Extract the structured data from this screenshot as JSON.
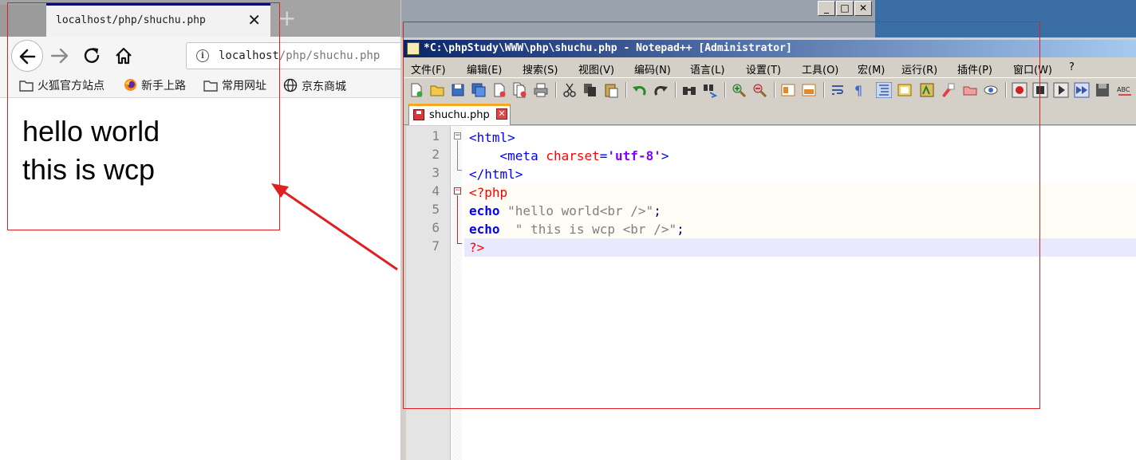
{
  "browser": {
    "tab_title": "localhost/php/shuchu.php",
    "tab_close": "✕",
    "new_tab": "+",
    "url_host": "localhost",
    "url_path": "/php/shuchu.php",
    "bookmarks": [
      {
        "label": "火狐官方站点",
        "icon": "folder-icon"
      },
      {
        "label": "新手上路",
        "icon": "firefox-icon"
      },
      {
        "label": "常用网址",
        "icon": "folder-icon"
      },
      {
        "label": "京东商城",
        "icon": "globe-icon"
      }
    ],
    "page_lines": [
      "hello world",
      "this is wcp"
    ]
  },
  "window_buttons": {
    "minimize": "_",
    "maximize": "□",
    "close": "✕"
  },
  "notepad": {
    "title": "*C:\\phpStudy\\WWW\\php\\shuchu.php - Notepad++ [Administrator]",
    "menu": [
      "文件(F)",
      "编辑(E)",
      "搜索(S)",
      "视图(V)",
      "编码(N)",
      "语言(L)",
      "设置(T)",
      "工具(O)",
      "宏(M)",
      "运行(R)",
      "插件(P)",
      "窗口(W)",
      "?"
    ],
    "tab_label": "shuchu.php",
    "line_numbers": [
      "1",
      "2",
      "3",
      "4",
      "5",
      "6",
      "7"
    ],
    "code": {
      "l1_tag": "<html>",
      "l2_indent": "    ",
      "l2_open": "<meta ",
      "l2_attr": "charset",
      "l2_eq": "=",
      "l2_val": "'utf-8'",
      "l2_close": ">",
      "l3_tag": "</html>",
      "l4_php": "<?php",
      "l5_kw": "echo",
      "l5_str": " \"hello world<br />\"",
      "l5_semi": ";",
      "l6_kw": "echo",
      "l6_str": "  \" this is wcp <br />\"",
      "l6_semi": ";",
      "l7_php": "?>"
    }
  },
  "colors": {
    "annotation_red": "#e02020",
    "title_gradient_start": "#0a246a",
    "title_gradient_end": "#a6caf0",
    "current_line": "#e8e8ff",
    "php_block": "#fefcf5"
  }
}
